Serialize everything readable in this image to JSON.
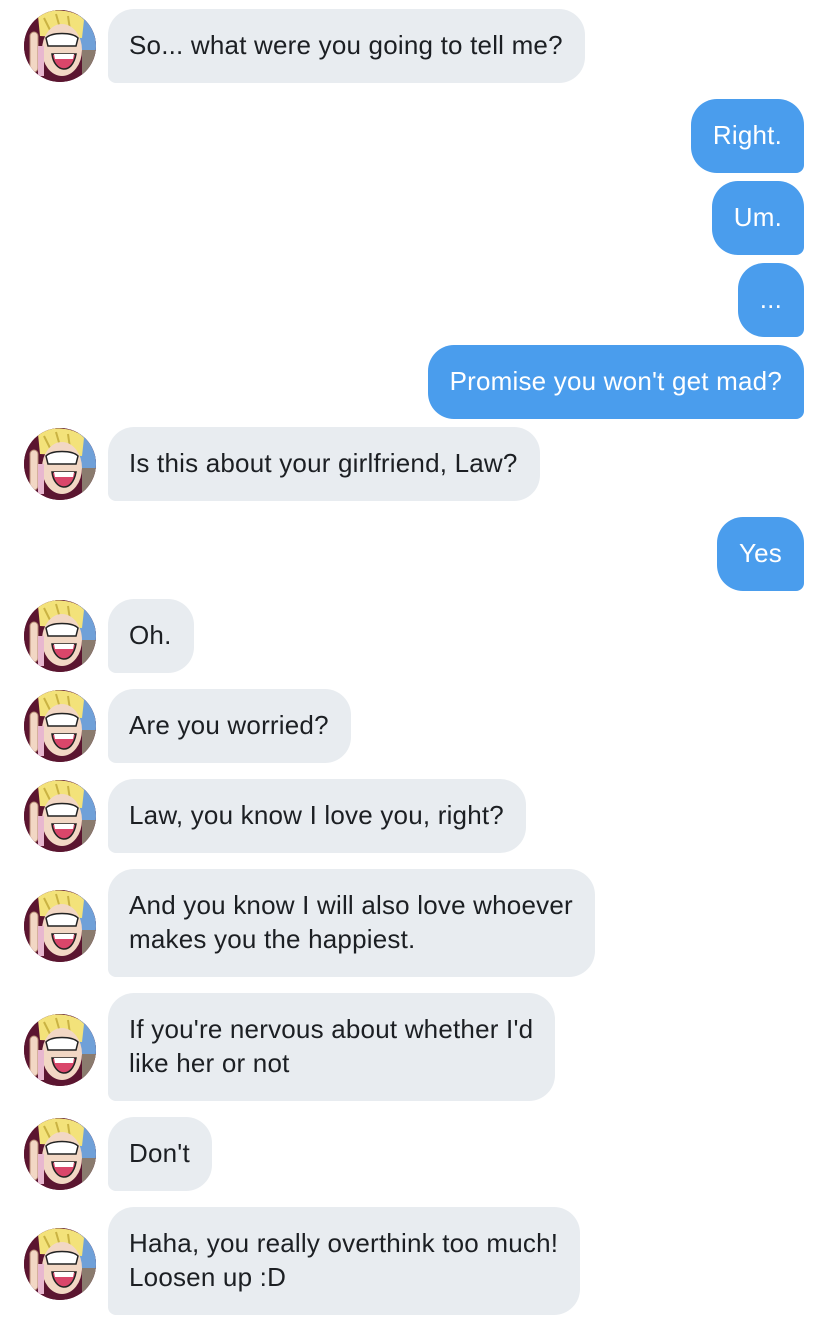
{
  "conversation": {
    "messages": [
      {
        "sender": "them",
        "lines": [
          "So... what were you going to tell me?"
        ]
      },
      {
        "sender": "me",
        "lines": [
          "Right."
        ]
      },
      {
        "sender": "me",
        "lines": [
          "Um."
        ]
      },
      {
        "sender": "me",
        "lines": [
          "..."
        ]
      },
      {
        "sender": "me",
        "lines": [
          "Promise you won't get mad?"
        ]
      },
      {
        "sender": "them",
        "lines": [
          "Is this about your girlfriend, Law?"
        ]
      },
      {
        "sender": "me",
        "lines": [
          "Yes"
        ]
      },
      {
        "sender": "them",
        "lines": [
          "Oh."
        ]
      },
      {
        "sender": "them",
        "lines": [
          "Are you worried?"
        ]
      },
      {
        "sender": "them",
        "lines": [
          "Law, you know I love you, right?"
        ]
      },
      {
        "sender": "them",
        "lines": [
          "And you know I will also love whoever",
          "makes you the happiest."
        ]
      },
      {
        "sender": "them",
        "lines": [
          "If you're nervous about whether I'd",
          "like her or not"
        ]
      },
      {
        "sender": "them",
        "lines": [
          "Don't"
        ]
      },
      {
        "sender": "them",
        "lines": [
          "Haha, you really overthink too much!",
          "Loosen up :D"
        ]
      }
    ]
  },
  "colors": {
    "incoming_bubble": "#e8ecf0",
    "outgoing_bubble": "#4a9ded",
    "incoming_text": "#1c1f23",
    "outgoing_text": "#ffffff"
  },
  "icons": {
    "avatar": "cartoon-character-avatar"
  }
}
